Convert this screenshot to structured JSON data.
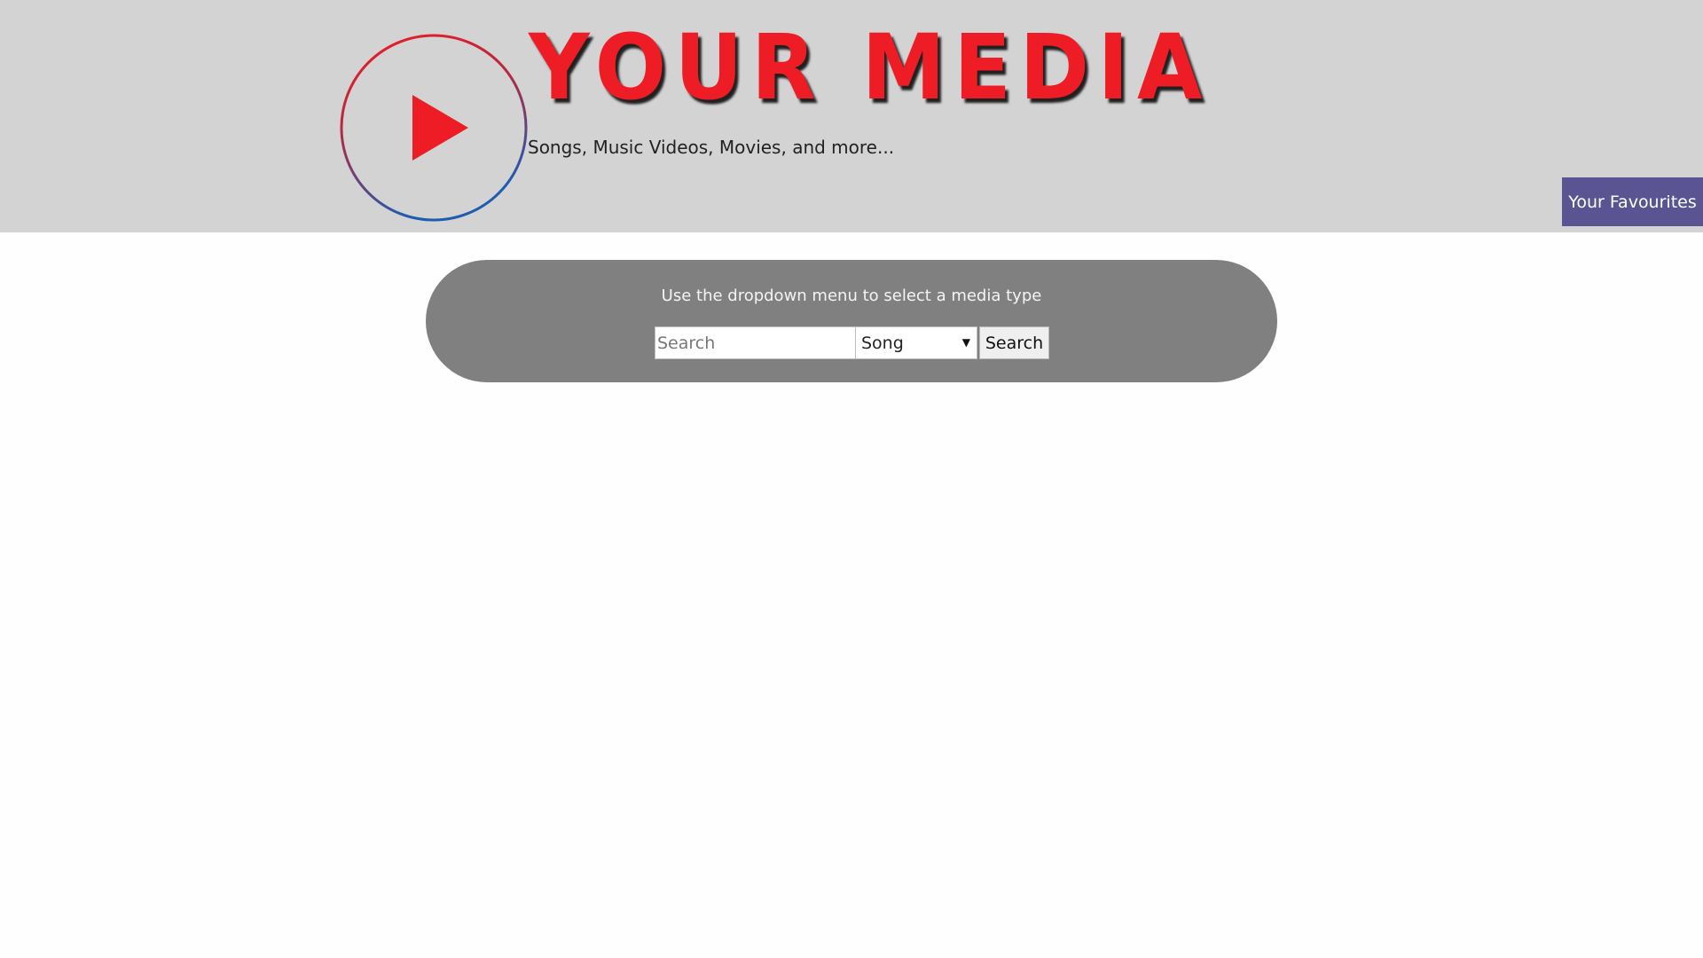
{
  "header": {
    "title": "YOUR MEDIA",
    "tagline": "Songs, Music Videos, Movies, and more...",
    "logo_icon": "play-icon",
    "favourites_label": "Your Favourites",
    "colors": {
      "header_bg": "#d3d3d3",
      "title_red": "#ee1c24",
      "favourites_bg": "#5a5592"
    }
  },
  "search": {
    "instruction": "Use the dropdown menu to select a media type",
    "placeholder": "Search",
    "value": "",
    "media_type_selected": "Song",
    "button_label": "Search",
    "panel_color": "#808080"
  }
}
